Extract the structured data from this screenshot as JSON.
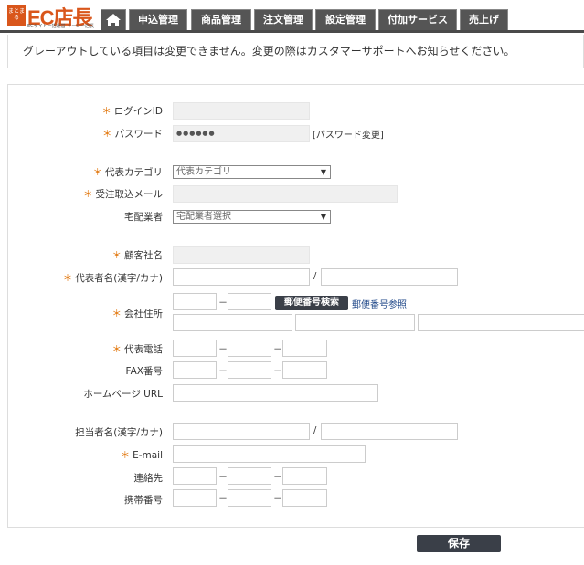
{
  "header": {
    "logo": {
      "mark": "まとまる",
      "title": "EC店長",
      "subtitle": "ECサイト一括運営 イーシー店長"
    },
    "tabs": [
      {
        "label": "申込管理"
      },
      {
        "label": "商品管理"
      },
      {
        "label": "注文管理"
      },
      {
        "label": "設定管理"
      },
      {
        "label": "付加サービス"
      },
      {
        "label": "売上げ"
      }
    ]
  },
  "notice": "グレーアウトしている項目は変更できません。変更の際はカスタマーサポートへお知らせください。",
  "form": {
    "required_mark": "＊",
    "labels": {
      "login_id": "ログインID",
      "password": "パスワード",
      "category": "代表カテゴリ",
      "order_mail": "受注取込メール",
      "carrier": "宅配業者",
      "company": "顧客社名",
      "rep_name": "代表者名(漢字/カナ)",
      "address": "会社住所",
      "rep_phone": "代表電話",
      "fax": "FAX番号",
      "homepage": "ホームページ URL",
      "contact_name": "担当者名(漢字/カナ)",
      "email": "E-mail",
      "contact": "連絡先",
      "mobile": "携帯番号"
    },
    "password_value": "●●●●●●",
    "password_change_link": "[パスワード変更]",
    "category_select": "代表カテゴリ",
    "carrier_select": "宅配業者選択",
    "zip_search_button": "郵便番号検索",
    "zip_reference_link": "郵便番号参照",
    "slash": "/",
    "dash": "－",
    "save_button": "保存"
  }
}
